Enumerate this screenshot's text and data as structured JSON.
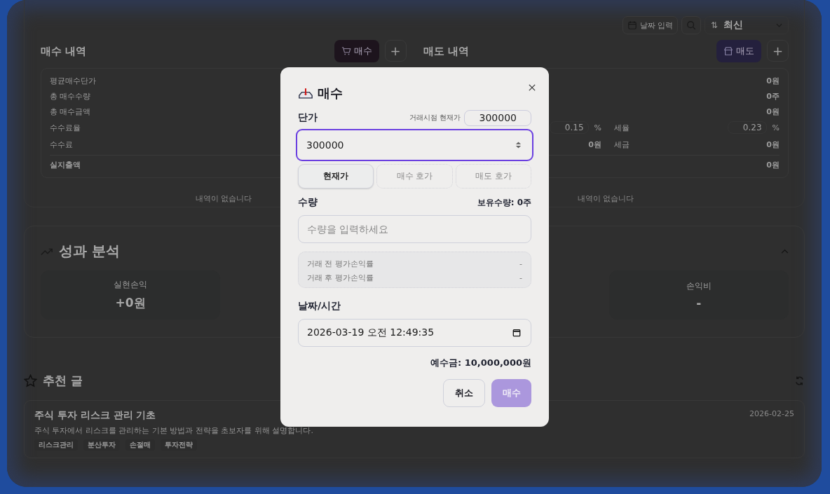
{
  "toolbar": {
    "date_button": "날짜 입력",
    "sort": {
      "icon": "⇅",
      "value": "최신"
    }
  },
  "history": {
    "buy": {
      "title": "매수 내역",
      "add_button": "매수",
      "plus_button": "+",
      "empty": "내역이 없습니다"
    },
    "sell": {
      "title": "매도 내역",
      "add_button": "매도",
      "plus_button": "+",
      "empty": "내역이 없습니다"
    },
    "summary": [
      {
        "kind": "single",
        "label": "평균매수단가",
        "value": "0원"
      },
      {
        "kind": "single",
        "label": "총 매수수량",
        "value": "0주"
      },
      {
        "kind": "single",
        "label": "총 매수금액",
        "value": "0원"
      },
      {
        "kind": "pair",
        "cells": [
          {
            "kind": "rate",
            "label": "수수료율",
            "value": "0.15",
            "unit": "%"
          },
          {
            "kind": "rate",
            "label": "세율",
            "value": "0.23",
            "unit": "%"
          }
        ]
      },
      {
        "kind": "pair",
        "cells": [
          {
            "kind": "amount",
            "label": "수수료",
            "value": "0원"
          },
          {
            "kind": "amount",
            "label": "세금",
            "value": "0원"
          }
        ]
      },
      {
        "kind": "total",
        "label": "실지출액",
        "value": "0원"
      }
    ]
  },
  "performance": {
    "title": "성과 분석",
    "expanded": true,
    "stats": [
      {
        "label": "실현손익",
        "value": "+0원"
      },
      {
        "label": "손익비",
        "value": "-"
      }
    ]
  },
  "recommended": {
    "title": "추천 글",
    "articles": [
      {
        "title": "주식 투자 리스크 관리 기초",
        "date": "2026-02-25",
        "summary": "주식 투자에서 리스크를 관리하는 기본 방법과 전략을 초보자를 위해 설명합니다.",
        "tags": [
          "리스크관리",
          "분산투자",
          "손절매",
          "투자전략"
        ]
      }
    ]
  },
  "modal": {
    "title": "매수",
    "price": {
      "label": "단가",
      "market_label": "거래시점 현재가",
      "market_value": "300000",
      "value": "300000"
    },
    "price_presets": [
      {
        "label": "현재가",
        "selected": true,
        "disabled": false
      },
      {
        "label": "매수 호가",
        "selected": false,
        "disabled": true
      },
      {
        "label": "매도 호가",
        "selected": false,
        "disabled": true
      }
    ],
    "quantity": {
      "label": "수량",
      "holding": "보유수량: 0주",
      "placeholder": "수량을 입력하세요"
    },
    "pnl": [
      {
        "label": "거래 전 평가손익률",
        "value": "-"
      },
      {
        "label": "거래 후 평가손익률",
        "value": "-"
      }
    ],
    "datetime": {
      "label": "날짜/시간",
      "value": "2026-03-19 오전 12:49:35"
    },
    "deposit": "예수금: 10,000,000원",
    "cancel_button": "취소",
    "submit": {
      "label": "매수",
      "disabled": true
    }
  }
}
